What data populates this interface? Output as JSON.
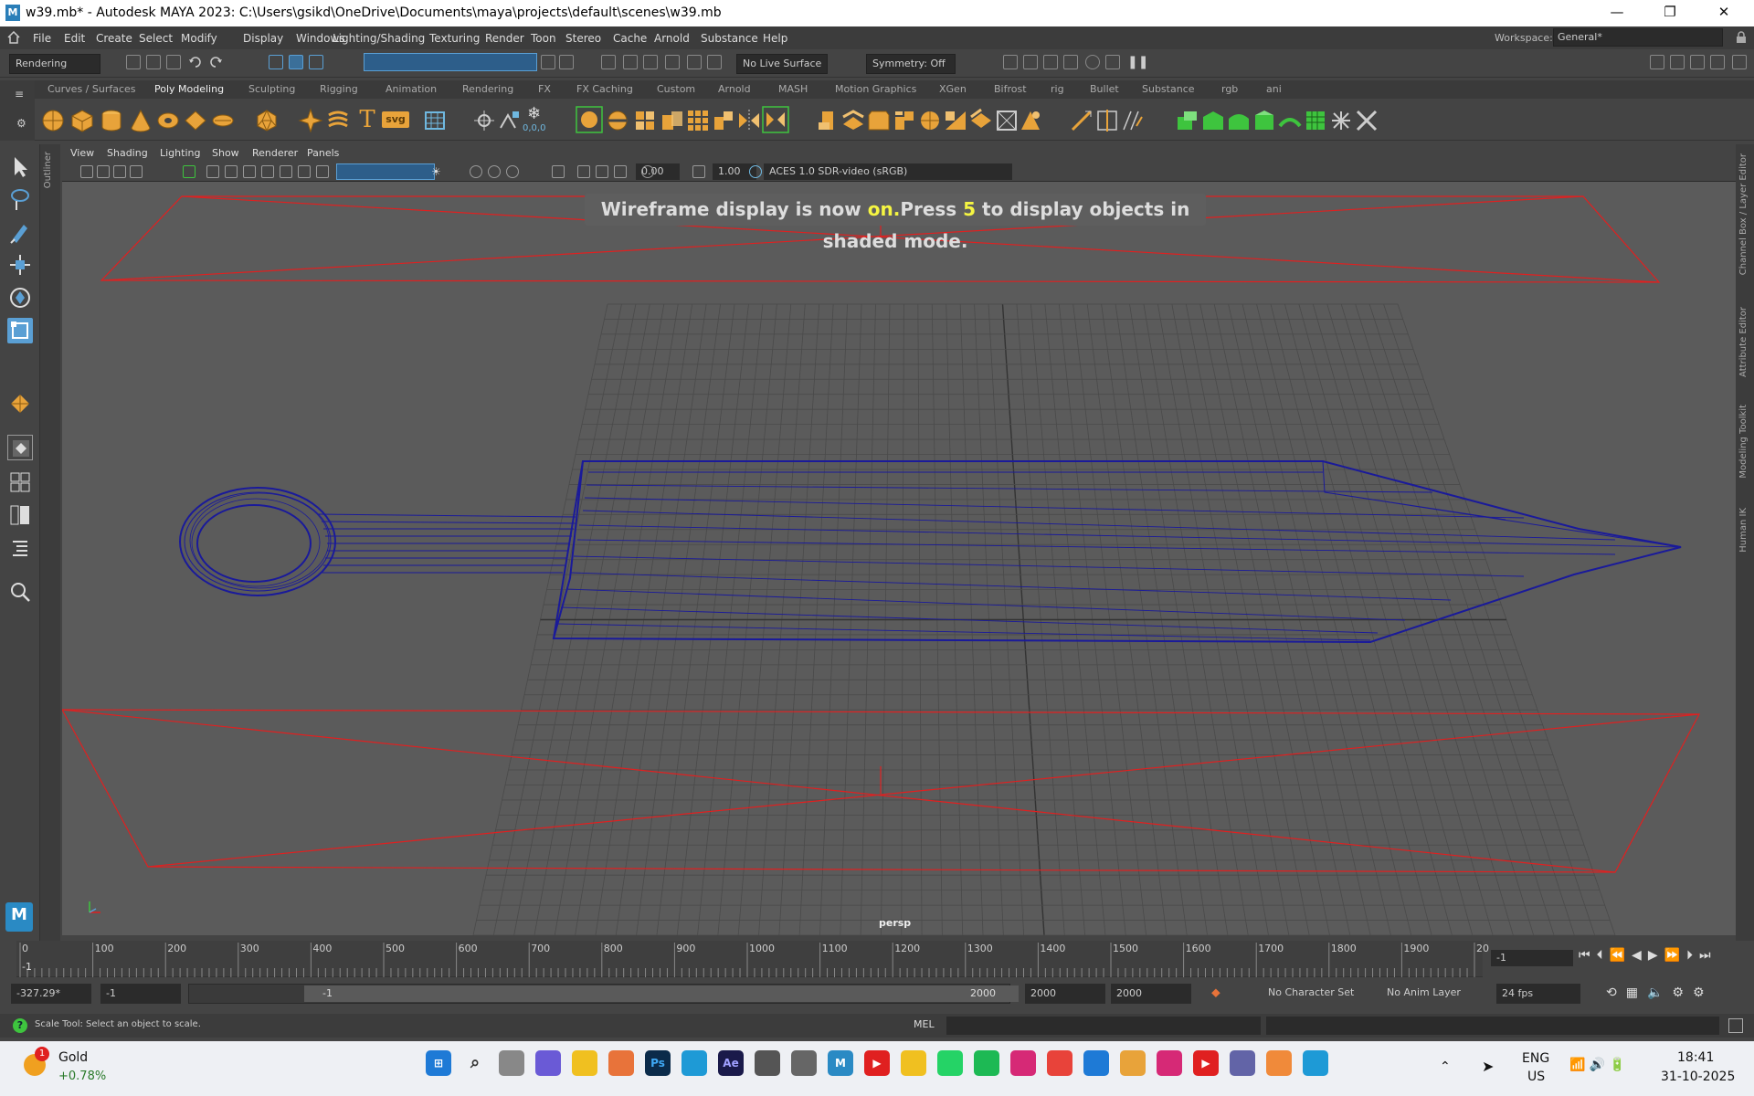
{
  "window": {
    "app_icon": "M",
    "title": "w39.mb* - Autodesk MAYA 2023: C:\\Users\\gsikd\\OneDrive\\Documents\\maya\\projects\\default\\scenes\\w39.mb",
    "minimize": "—",
    "maximize": "❐",
    "close": "✕"
  },
  "menubar": {
    "items": [
      "File",
      "Edit",
      "Create",
      "Select",
      "Modify",
      "Display",
      "Windows",
      "Lighting/Shading",
      "Texturing",
      "Render",
      "Toon",
      "Stereo",
      "Cache",
      "Arnold",
      "Substance",
      "Help"
    ],
    "workspace_label": "Workspace:",
    "workspace_value": "General*"
  },
  "statusline": {
    "menuset": "Rendering",
    "live_surface": "No Live Surface",
    "symmetry": "Symmetry: Off"
  },
  "shelf": {
    "tabs": [
      "Curves / Surfaces",
      "Poly Modeling",
      "Sculpting",
      "Rigging",
      "Animation",
      "Rendering",
      "FX",
      "FX Caching",
      "Custom",
      "Arnold",
      "MASH",
      "Motion Graphics",
      "XGen",
      "Bifrost",
      "rig",
      "Bullet",
      "Substance",
      "rgb",
      "ani"
    ],
    "active_tab": "Poly Modeling",
    "text_tool": "T",
    "svg_tool": "svg",
    "coord_label": "0,0,0"
  },
  "panel": {
    "menus": [
      "View",
      "Shading",
      "Lighting",
      "Show",
      "Renderer",
      "Panels"
    ],
    "exposure": "0.00",
    "gamma": "1.00",
    "colorspace": "ACES 1.0 SDR-video (sRGB)",
    "camera_label": "persp"
  },
  "hud": {
    "msg_prefix": "Wireframe display is now ",
    "msg_on": "on.",
    "msg_mid": "Press ",
    "msg_key": "5",
    "msg_suffix": " to display objects in shaded mode."
  },
  "side_panels": {
    "outliner": "Outliner",
    "right": [
      "Channel Box / Layer Editor",
      "Attribute Editor",
      "Modeling Toolkit",
      "Human IK"
    ]
  },
  "timeline": {
    "ticks": [
      "0",
      "100",
      "200",
      "300",
      "400",
      "500",
      "600",
      "700",
      "800",
      "900",
      "1000",
      "1100",
      "1200",
      "1300",
      "1400",
      "1500",
      "1600",
      "1700",
      "1800",
      "1900",
      "20"
    ],
    "start_marker": "-1",
    "current_frame": "-1"
  },
  "range": {
    "field1": "-327.29*",
    "field2": "-1",
    "slider_start": "-1",
    "slider_end": "2000",
    "end1": "2000",
    "end2": "2000",
    "character_set": "No Character Set",
    "anim_layer": "No Anim Layer",
    "fps": "24 fps"
  },
  "cmdline": {
    "help_text": "Scale Tool: Select an object to scale.",
    "lang": "MEL"
  },
  "taskbar": {
    "badge": "1",
    "stock_name": "Gold",
    "stock_change": "+0.78%",
    "lang_top": "ENG",
    "lang_bottom": "US",
    "time": "18:41",
    "date": "31-10-2025"
  },
  "colors": {
    "viewport_bg": "#5b5b5b",
    "grid": "#4a4a4a",
    "wireframe": "#1a1a9a",
    "bbox": "#e02020",
    "shelf_icon": "#e8a33a",
    "highlight": "#f5f542"
  }
}
